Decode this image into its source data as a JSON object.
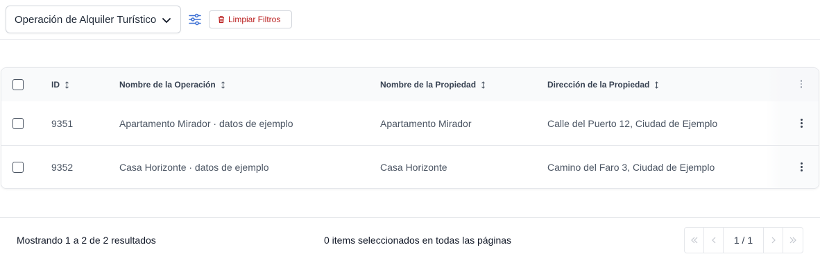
{
  "toolbar": {
    "dropdown_value": "Operación de Alquiler Turístico",
    "dropdown_icon": "chevron-down-icon",
    "filter_icon": "sliders-icon",
    "clear_label": "Limpiar Filtros",
    "clear_icon": "trash-icon",
    "accent_color": "#3b6fd4",
    "danger_color": "#b91c1c"
  },
  "table": {
    "columns": {
      "id": "ID",
      "operation_name": "Nombre de la Operación",
      "property_name": "Nombre de la Propiedad",
      "property_address": "Dirección de la Propiedad"
    },
    "rows": [
      {
        "id": "9351",
        "operation_name": "Apartamento Mirador · datos de ejemplo",
        "property_name": "Apartamento Mirador",
        "property_address": "Calle del Puerto 12, Ciudad de Ejemplo"
      },
      {
        "id": "9352",
        "operation_name": "Casa Horizonte · datos de ejemplo",
        "property_name": "Casa Horizonte",
        "property_address": "Camino del Faro 3, Ciudad de Ejemplo"
      }
    ]
  },
  "footer": {
    "results_text": "Mostrando 1 a 2 de 2 resultados",
    "selection_text": "0 items seleccionados en todas las páginas",
    "page_indicator": "1 / 1"
  }
}
